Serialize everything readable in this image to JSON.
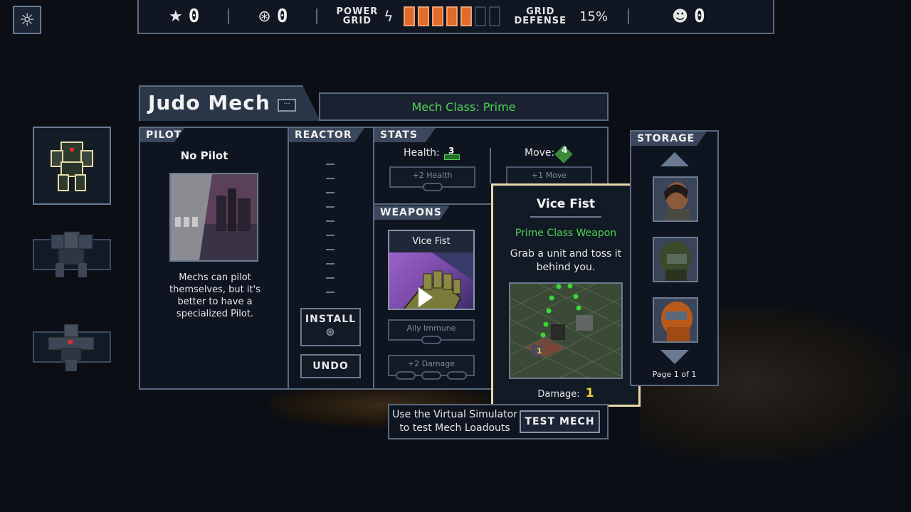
{
  "topbar": {
    "reputation": "0",
    "cores": "0",
    "power_grid_label": "POWER\nGRID",
    "power_bars_total": 7,
    "power_bars_filled": 5,
    "grid_defense_label": "GRID\nDEFENSE",
    "grid_defense_pct": "15%",
    "pilots": "0"
  },
  "mech": {
    "name": "Judo Mech",
    "class_text": "Mech Class: Prime"
  },
  "sections": {
    "pilot": "PILOT",
    "reactor": "REACTOR",
    "stats": "STATS",
    "weapons": "WEAPONS",
    "storage": "STORAGE"
  },
  "pilot": {
    "name": "No Pilot",
    "description": "Mechs can pilot themselves, but it's better to have a specialized Pilot."
  },
  "reactor": {
    "install": "INSTALL",
    "undo": "UNDO"
  },
  "stats": {
    "health_label": "Health:",
    "health_value": "3",
    "move_label": "Move:",
    "move_value": "4",
    "health_upgrade": "+2 Health",
    "move_upgrade": "+1 Move"
  },
  "weapon": {
    "name": "Vice Fist",
    "upgrade1": "Ally Immune",
    "upgrade2": "+2 Damage"
  },
  "tooltip": {
    "title": "Vice Fist",
    "class": "Prime Class Weapon",
    "description": "Grab a unit and toss it behind you.",
    "damage_label": "Damage:",
    "damage_value": "1",
    "preview_tile_number": "1"
  },
  "test": {
    "hint": "Use the Virtual Simulator to test Mech Loadouts",
    "button": "TEST MECH"
  },
  "storage": {
    "page": "Page 1 of 1"
  },
  "colors": {
    "accent_green": "#4fd44f",
    "power_on": "#e06b2a",
    "tooltip_border": "#e8d9a8",
    "damage_yellow": "#f0d040"
  }
}
